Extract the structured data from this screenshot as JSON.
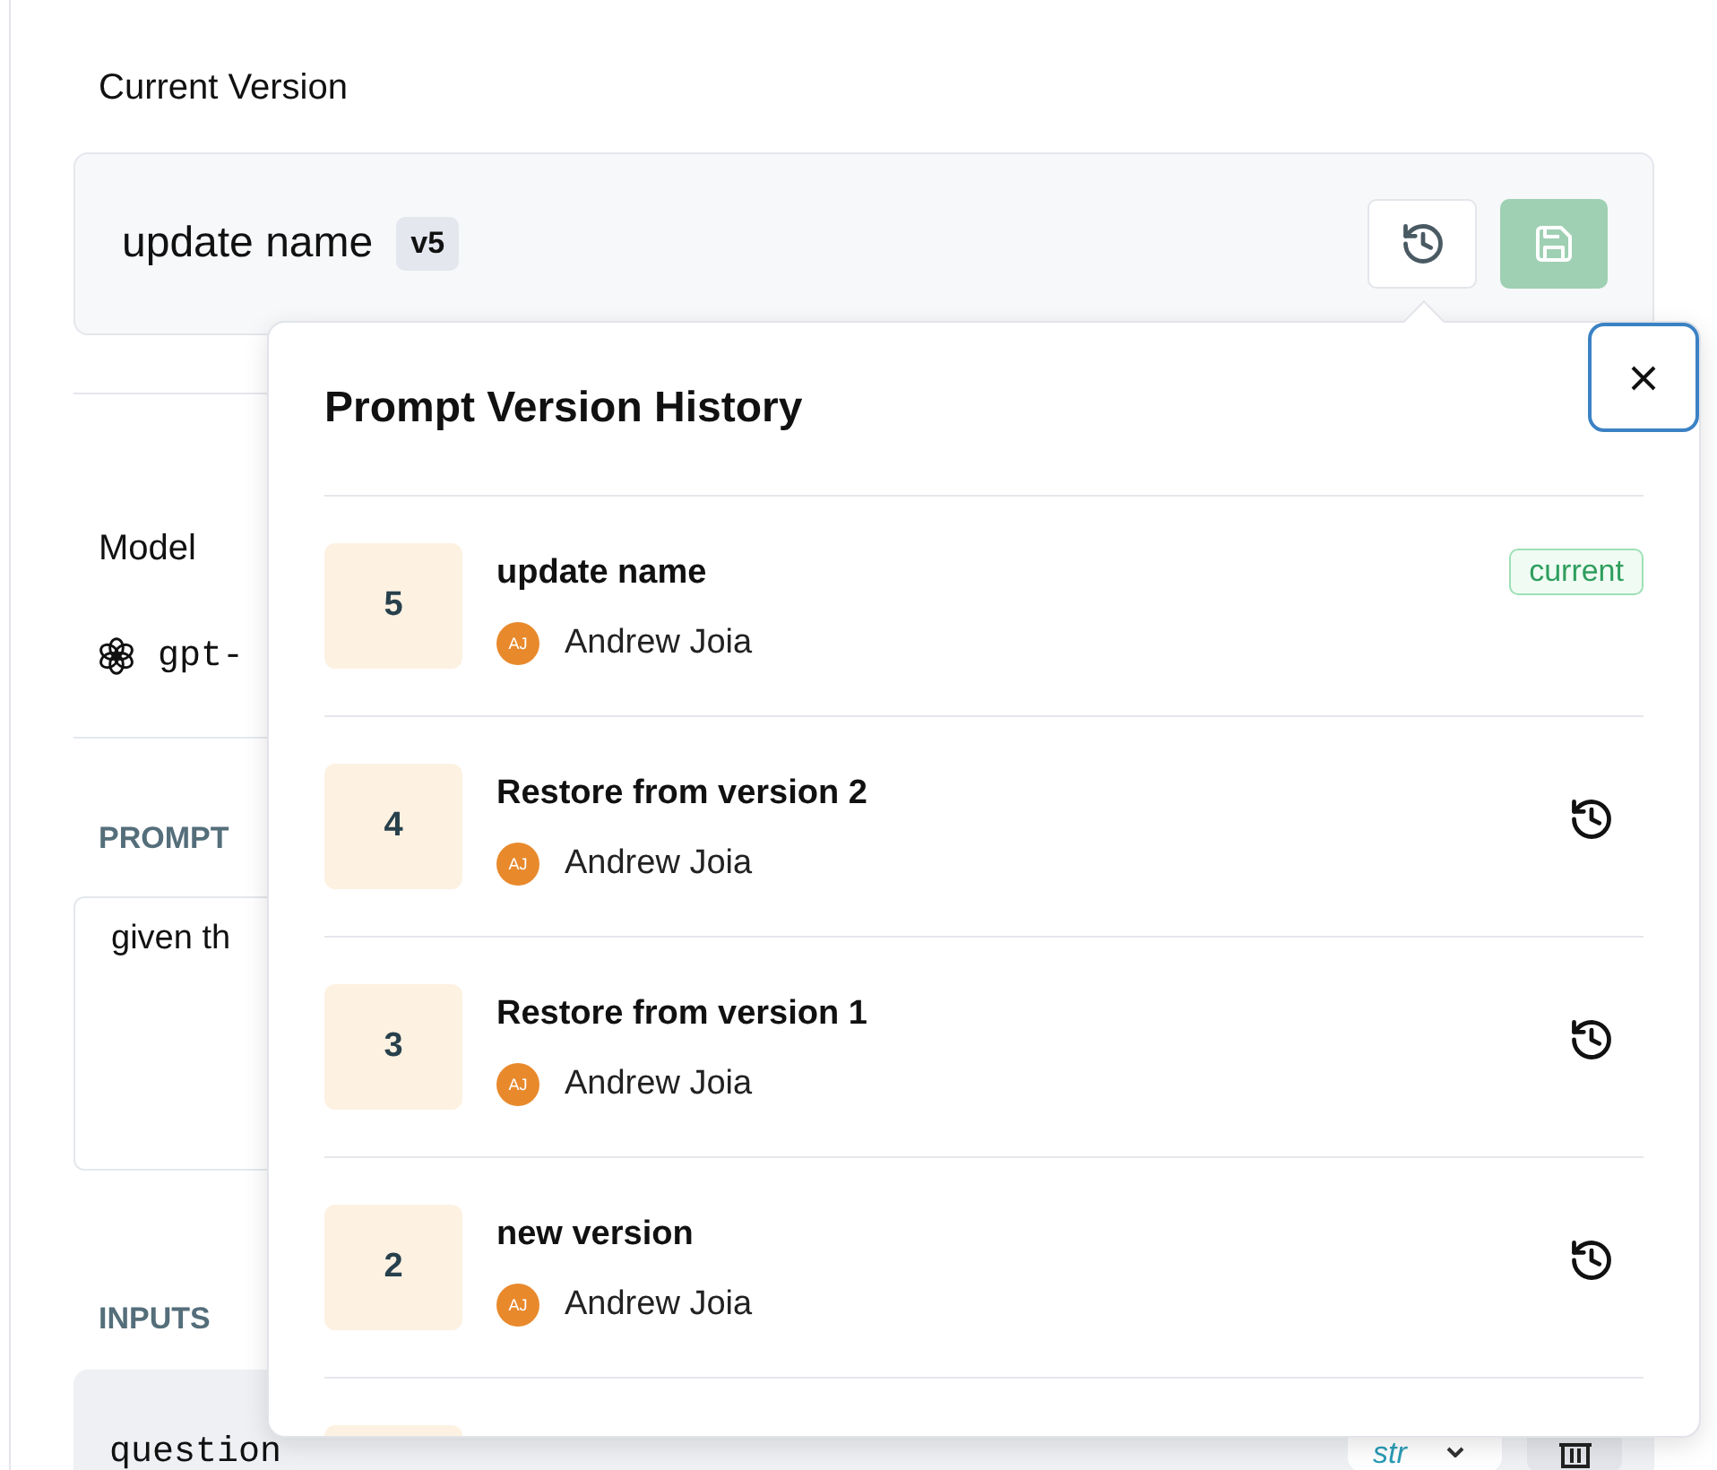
{
  "current_version": {
    "heading": "Current Version",
    "name": "update name",
    "badge": "v5"
  },
  "model": {
    "label": "Model",
    "value": "gpt-"
  },
  "prompt": {
    "label": "PROMPT",
    "value": "given th"
  },
  "inputs": {
    "label": "INPUTS",
    "rows": [
      {
        "name": "question",
        "type": "str"
      }
    ]
  },
  "history": {
    "title": "Prompt Version History",
    "versions": [
      {
        "number": "5",
        "title": "update name",
        "initials": "AJ",
        "author": "Andrew Joia",
        "kind": "current",
        "badge": "current"
      },
      {
        "number": "4",
        "title": "Restore from version 2",
        "initials": "AJ",
        "author": "Andrew Joia",
        "kind": "restorable"
      },
      {
        "number": "3",
        "title": "Restore from version 1",
        "initials": "AJ",
        "author": "Andrew Joia",
        "kind": "restorable"
      },
      {
        "number": "2",
        "title": "new version",
        "initials": "AJ",
        "author": "Andrew Joia",
        "kind": "restorable"
      },
      {
        "kind": "hidden"
      }
    ]
  }
}
